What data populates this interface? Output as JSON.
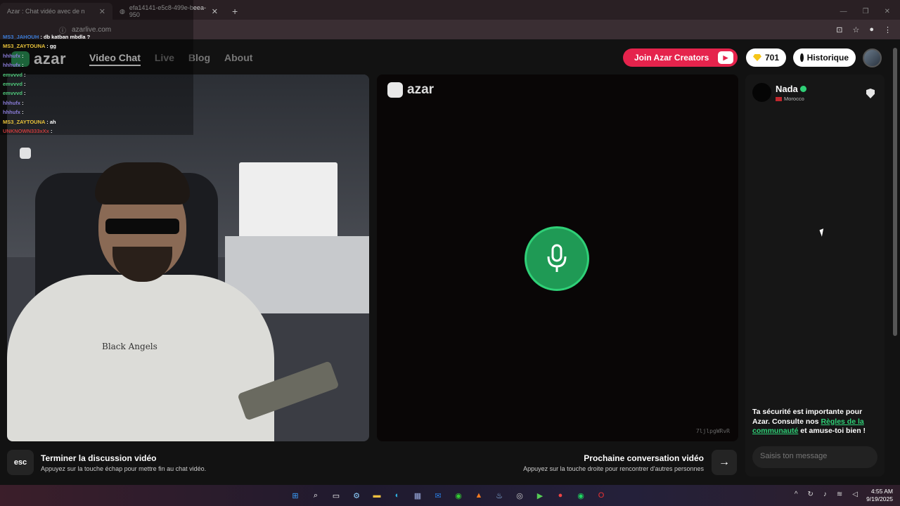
{
  "browser": {
    "tabs": [
      {
        "title": "Azar : Chat vidéo avec de n"
      },
      {
        "title": "efa14141-e5c8-499e-beea-950"
      }
    ],
    "url": "azarlive.com"
  },
  "header": {
    "logo": "azar",
    "nav": [
      "Video Chat",
      "Live",
      "Blog",
      "About"
    ],
    "join_label": "Join Azar Creators",
    "gems": "701",
    "history_label": "Historique"
  },
  "overlay_chat": [
    {
      "user": "MS3_JAHOUH",
      "text": ": db katban mbdla ?"
    },
    {
      "user": "MS3_ZAYTOUNA",
      "text": ": gg"
    },
    {
      "user": "hhhufx",
      "text": ":"
    },
    {
      "user": "hhhufx",
      "text": ":"
    },
    {
      "user": "emvvvd",
      "text": ":"
    },
    {
      "user": "emvvvd",
      "text": ":"
    },
    {
      "user": "emvvvd",
      "text": ":"
    },
    {
      "user": "hhhufx",
      "text": ":"
    },
    {
      "user": "hhhufx",
      "text": ":"
    },
    {
      "user": "MS3_ZAYTOUNA",
      "text": ": ah"
    },
    {
      "user": "UNKNOWN333xXx",
      "text": ":"
    }
  ],
  "camera": {
    "shirt_text": "Black Angels"
  },
  "remote": {
    "logo": "azar",
    "session_id": "7ljlpgWRvR"
  },
  "sidebar": {
    "peer_name": "Nada",
    "peer_country": "Morocco",
    "safety_prefix": "Ta sécurité est importante pour Azar. Consulte nos ",
    "safety_link": "Règles de la communauté",
    "safety_suffix": " et amuse-toi bien !",
    "message_placeholder": "Saisis ton message"
  },
  "footer": {
    "esc_key": "esc",
    "end_title": "Terminer la discussion vidéo",
    "end_desc": "Appuyez sur la touche échap pour mettre fin au chat vidéo.",
    "next_title": "Prochaine conversation vidéo",
    "next_desc": "Appuyez sur la touche droite pour rencontrer d'autres personnes"
  },
  "taskbar": {
    "time": "4:55 AM",
    "date": "9/19/2025"
  },
  "colors": {
    "accent_green": "#2fd077",
    "join_red": "#e5234c"
  }
}
